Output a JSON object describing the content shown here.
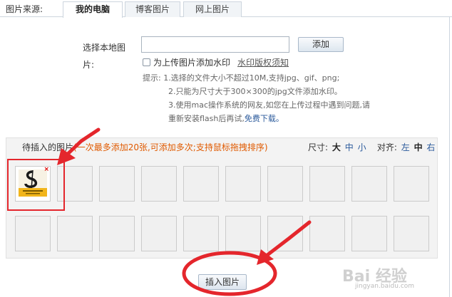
{
  "header": {
    "source_label": "图片来源:",
    "tabs": [
      {
        "label": "我的电脑",
        "active": true
      },
      {
        "label": "博客图片",
        "active": false
      },
      {
        "label": "网上图片",
        "active": false
      }
    ]
  },
  "upload": {
    "label_line1": "选择本地图",
    "label_line2": "片:",
    "file_value": "",
    "add_label": "添加",
    "watermark_checkbox_label": "为上传图片添加水印",
    "watermark_checked": false,
    "watermark_link": "水印版权须知"
  },
  "tips": {
    "prefix": "提示:",
    "line1": "1.选择的文件大小不超过10M,支持jpg、gif、png;",
    "line2": "2.只能为尺寸大于300×300的jpg文件添加水印。",
    "line3": "3.使用mac操作系统的网友,如您在上传过程中遇到问题,请",
    "line4_text": "重新安装flash后再试,",
    "download_link": "免费下载。"
  },
  "panel": {
    "title": "待插入的图片",
    "hint": "(一次最多添加20张,可添加多次;支持鼠标拖拽排序)",
    "size_label": "尺寸:",
    "size_options": [
      "大",
      "中",
      "小"
    ],
    "size_selected": "大",
    "align_label": "对齐:",
    "align_options": [
      "左",
      "中",
      "右"
    ],
    "align_selected": "中",
    "thumb_close": "×",
    "filled_slots": 1
  },
  "insert_label": "插入图片",
  "annotation": {
    "color": "#e4262c"
  },
  "watermark": {
    "main": "Bai 经验",
    "sub": "jingyan.baidu.com"
  }
}
